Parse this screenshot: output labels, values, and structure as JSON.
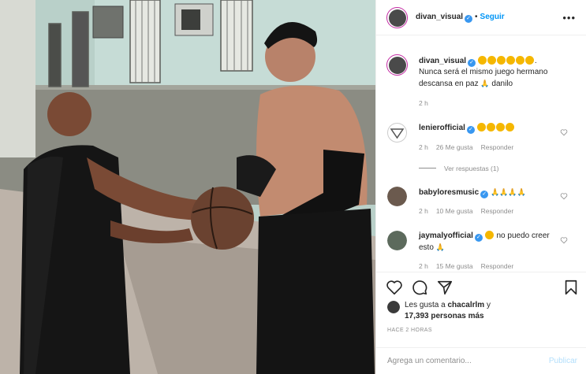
{
  "post": {
    "author": "divan_visual",
    "follow_label": "Seguir",
    "caption_suffix": ".",
    "caption_text": "Nunca será el mismo juego hermano descansa en paz",
    "caption_end": "danilo",
    "caption_time": "2 h"
  },
  "comments": [
    {
      "user": "lenierofficial",
      "time": "2 h",
      "likes": "26 Me gusta",
      "reply": "Responder",
      "view_replies": "Ver respuestas (1)"
    },
    {
      "user": "babylor​esmusic",
      "time": "2 h",
      "likes": "10 Me gusta",
      "reply": "Responder"
    },
    {
      "user": "jaymalyofficial",
      "text": "no puedo creer esto",
      "time": "2 h",
      "likes": "15 Me gusta",
      "reply": "Responder"
    }
  ],
  "likes_line1": "Les gusta a",
  "likes_user": "chacalrlm",
  "likes_line1_end": "y",
  "likes_line2": "17,393 personas más",
  "post_time": "HACE 2 HORAS",
  "comment_placeholder": "Agrega un comentario...",
  "publish_label": "Publicar",
  "colors": {
    "link": "#0095f6",
    "verified": "#3897f0",
    "muted": "#8e8e8e",
    "publish_disabled": "#b2dffc"
  },
  "icons": [
    "more-icon",
    "verified-icon",
    "heart-icon",
    "comment-icon",
    "share-icon",
    "bookmark-icon",
    "pray-emoji-icon",
    "sad-emoji-icon"
  ]
}
